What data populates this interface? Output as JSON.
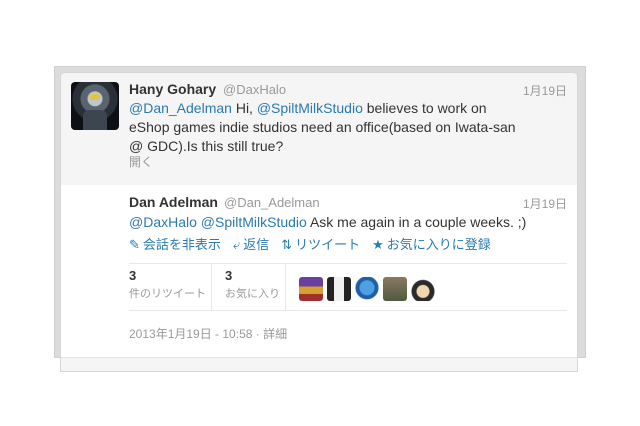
{
  "tweet1": {
    "name": "Hany Gohary",
    "handle": "@DaxHalo",
    "date": "1月19日",
    "mention1": "@Dan_Adelman",
    "text1": " Hi, ",
    "mention2": "@SpiltMilkStudio",
    "text2": " believes to work on eShop games indie studios need an office(based on Iwata-san @ GDC).Is this still true?",
    "open": "開く"
  },
  "tweet2": {
    "name": "Dan Adelman",
    "handle": "@Dan_Adelman",
    "date": "1月19日",
    "mention1": "@DaxHalo",
    "mention2": "@SpiltMilkStudio",
    "text": " Ask me again in a couple weeks. ;)",
    "actions": {
      "hide_icon": "comment-icon",
      "hide": "会話を非表示",
      "reply_icon": "reply-arrow-icon",
      "reply": "返信",
      "retweet_icon": "retweet-icon",
      "retweet": "リツイート",
      "favorite_icon": "star-icon",
      "favorite": "お気に入りに登録"
    },
    "stats": {
      "retweets": "3",
      "retweets_label": "件のリツイート",
      "favorites": "3",
      "favorites_label": "お気に入り"
    },
    "timestamp": "2013年1月19日 - 10:58 · 詳細"
  },
  "colors": {
    "link": "#2a7ab0",
    "muted": "#999999",
    "text": "#333333"
  }
}
